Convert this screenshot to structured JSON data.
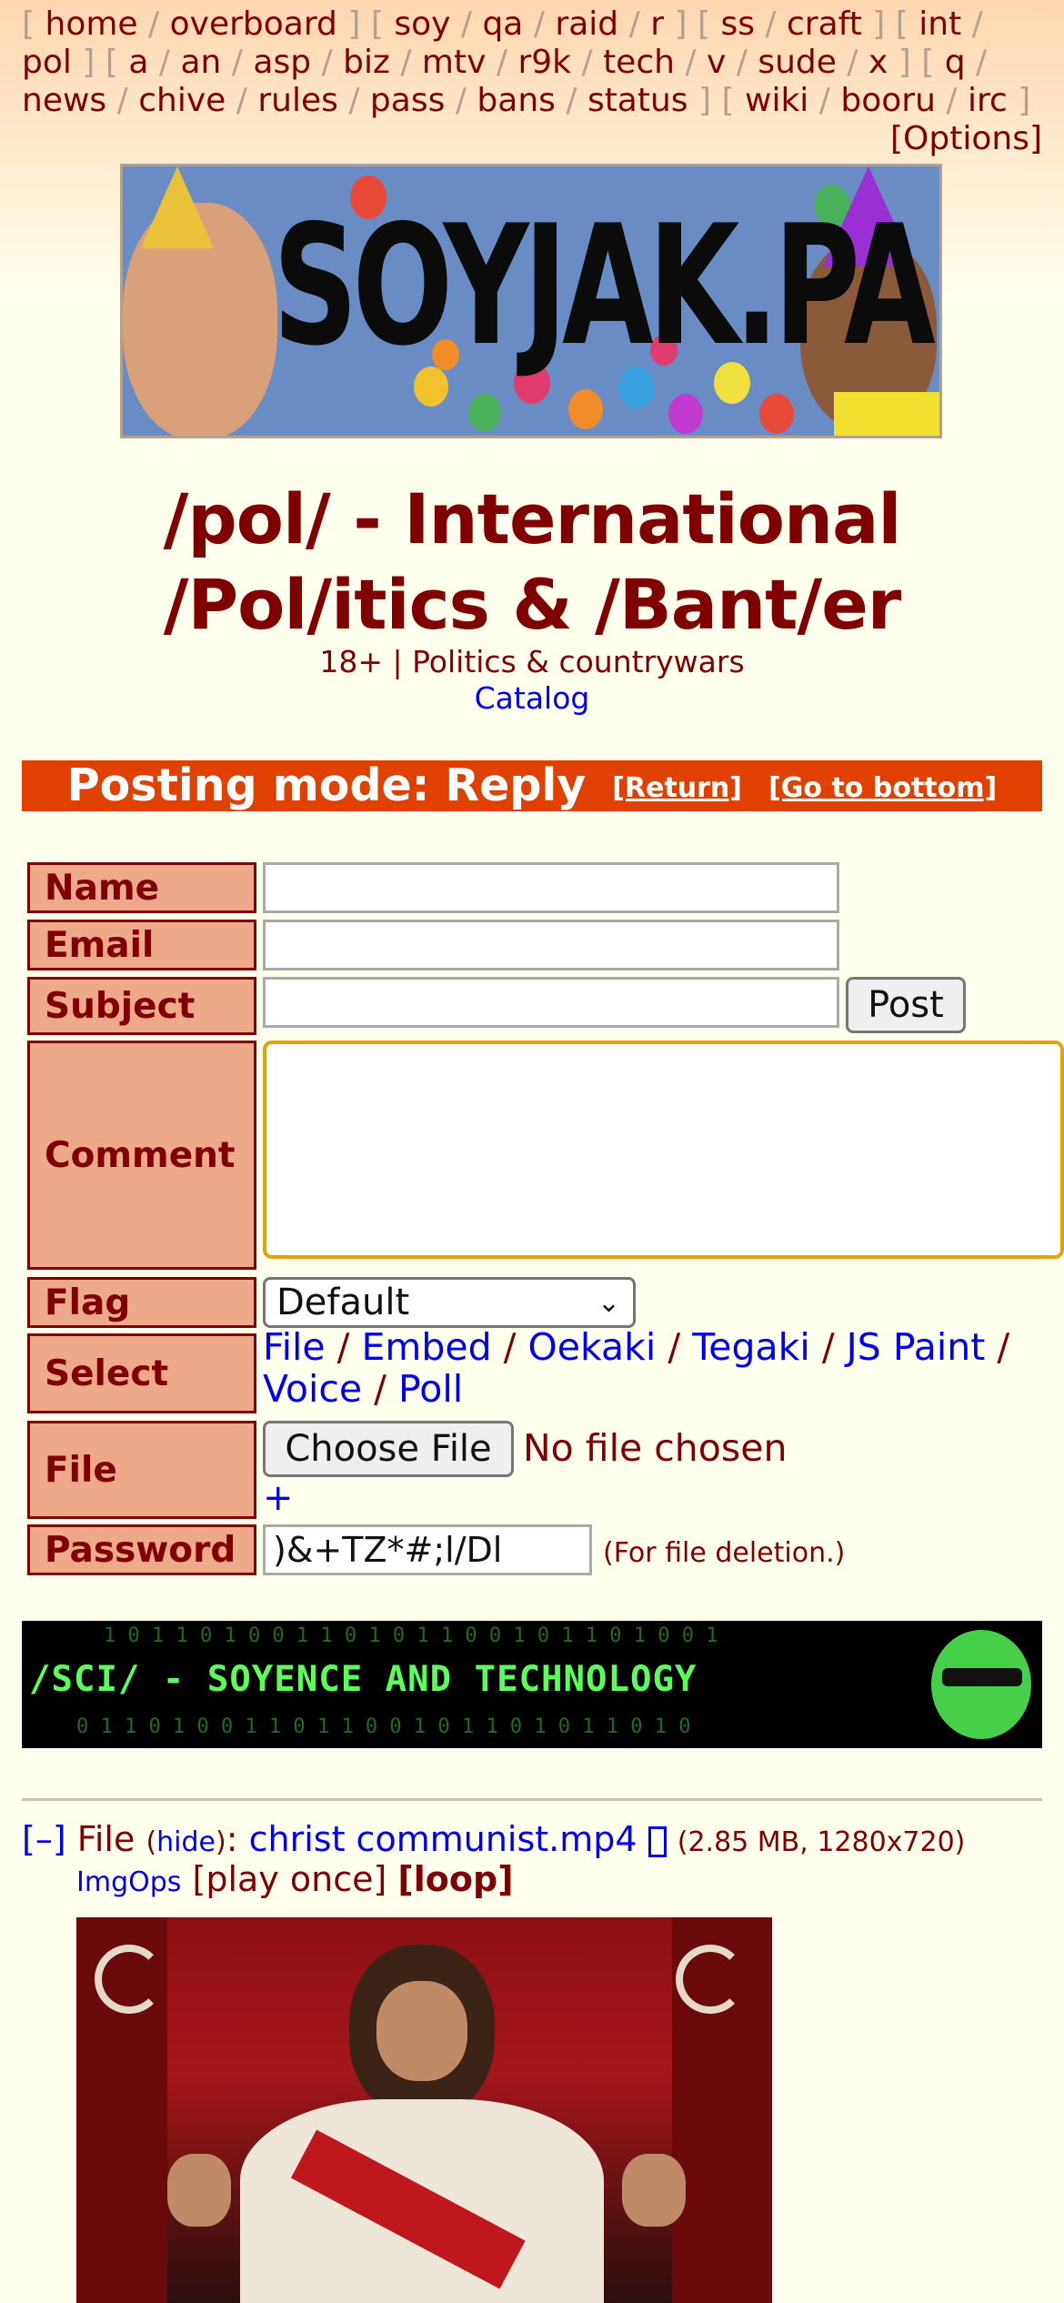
{
  "boardlist": {
    "groups": [
      [
        "home",
        "overboard"
      ],
      [
        "soy",
        "qa",
        "raid",
        "r"
      ],
      [
        "ss",
        "craft"
      ],
      [
        "int",
        "pol"
      ],
      [
        "a",
        "an",
        "asp",
        "biz",
        "mtv",
        "r9k",
        "tech",
        "v",
        "sude",
        "x"
      ],
      [
        "q",
        "news",
        "chive",
        "rules",
        "pass",
        "bans",
        "status"
      ],
      [
        "wiki",
        "booru",
        "irc"
      ]
    ],
    "options_label": "[Options]"
  },
  "banner": {
    "text": "SOYJAK.PARTY"
  },
  "board": {
    "title": "/pol/ - International /Pol/itics & /Bant/er",
    "subtitle": "18+ | Politics & countrywars",
    "catalog_link": "Catalog"
  },
  "posting_mode": {
    "label": "Posting mode: Reply",
    "return_link": "[Return]",
    "bottom_link": "[Go to bottom]"
  },
  "form": {
    "name_label": "Name",
    "email_label": "Email",
    "subject_label": "Subject",
    "post_button": "Post",
    "comment_label": "Comment",
    "flag_label": "Flag",
    "flag_value": "Default",
    "select_label": "Select",
    "select_links": [
      "File",
      "Embed",
      "Oekaki",
      "Tegaki",
      "JS Paint",
      "Voice",
      "Poll"
    ],
    "file_label": "File",
    "choose_file_button": "Choose File",
    "no_file_text": "No file chosen",
    "add_file": "+",
    "password_label": "Password",
    "password_value": ")&+TZ*#;l/Dl",
    "password_note": "(For file deletion.)"
  },
  "ad_banner": {
    "text": "/SCI/ - SOYENCE AND TECHNOLOGY"
  },
  "post": {
    "collapse": "[–]",
    "file_word": "File",
    "hide_link": "hide",
    "filename": "christ communist.mp4",
    "download_icon": "download-icon",
    "file_meta": "(2.85 MB, 1280x720)",
    "imgops": "ImgOps",
    "play_once": "[play once]",
    "loop": "[loop]"
  },
  "colors": {
    "accent": "#800000",
    "posting_mode_bg": "#e04000",
    "label_bg": "#eeaa88",
    "link": "#0000ee",
    "page_bg": "#ffffee"
  }
}
